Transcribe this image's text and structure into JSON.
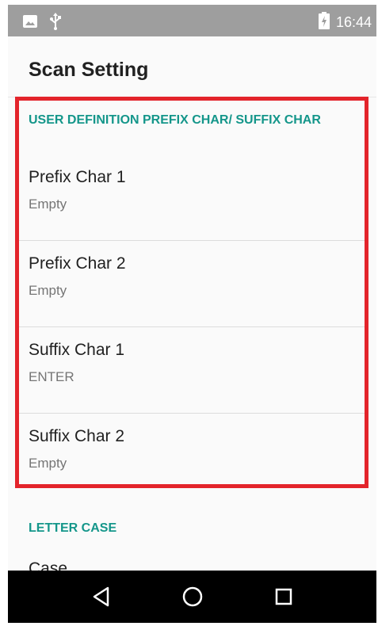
{
  "status_bar": {
    "time": "16:44",
    "left_icons": [
      "image-icon",
      "usb-icon"
    ],
    "right_icons": [
      "battery-charging-icon"
    ]
  },
  "app": {
    "title": "Scan Setting"
  },
  "sections": [
    {
      "header": "USER DEFINITION PREFIX CHAR/ SUFFIX CHAR",
      "items": [
        {
          "title": "Prefix Char 1",
          "summary": "Empty"
        },
        {
          "title": "Prefix Char 2",
          "summary": "Empty"
        },
        {
          "title": "Suffix Char 1",
          "summary": "ENTER"
        },
        {
          "title": "Suffix Char 2",
          "summary": "Empty"
        }
      ]
    },
    {
      "header": "LETTER CASE",
      "items": [
        {
          "title": "Case",
          "summary": ""
        }
      ]
    }
  ],
  "nav_bar": {
    "buttons": [
      "back-icon",
      "home-icon",
      "recents-icon"
    ]
  },
  "colors": {
    "accent": "#14968a",
    "highlight": "#e3242b",
    "status_bar": "#9e9e9e",
    "nav_bar": "#000000"
  }
}
